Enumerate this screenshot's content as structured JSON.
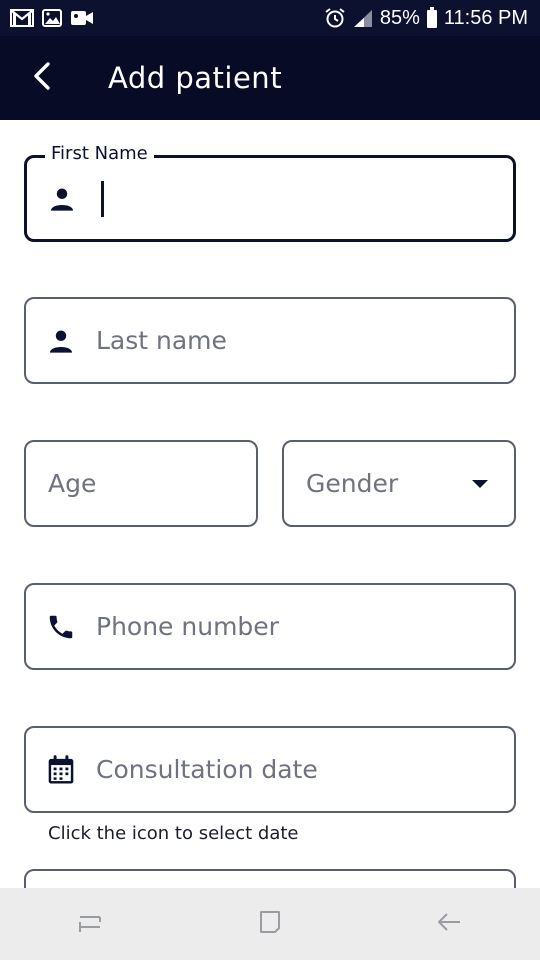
{
  "status_bar": {
    "battery": "85%",
    "time": "11:56 PM",
    "left_icons": [
      "gmail-icon",
      "gallery-icon",
      "video-icon"
    ],
    "right_icons": [
      "alarm-icon",
      "signal-icon",
      "battery-icon"
    ]
  },
  "app_bar": {
    "title": "Add patient",
    "back_icon": "back-arrow-icon"
  },
  "form": {
    "first_name": {
      "label": "First Name",
      "value": "",
      "icon": "person-icon"
    },
    "last_name": {
      "placeholder": "Last name",
      "icon": "person-icon"
    },
    "age": {
      "placeholder": "Age"
    },
    "gender": {
      "placeholder": "Gender",
      "icon": "dropdown-arrow-icon"
    },
    "phone": {
      "placeholder": "Phone number",
      "icon": "phone-icon"
    },
    "consultation_date": {
      "placeholder": "Consultation date",
      "icon": "calendar-icon",
      "helper": "Click the icon to select date"
    }
  },
  "nav_bar": {
    "buttons": [
      "recents-icon",
      "home-icon",
      "back-icon"
    ]
  },
  "colors": {
    "primary": "#070b26",
    "border": "#5a5f6e",
    "placeholder": "#6f7380",
    "nav_bg": "#ececec"
  }
}
